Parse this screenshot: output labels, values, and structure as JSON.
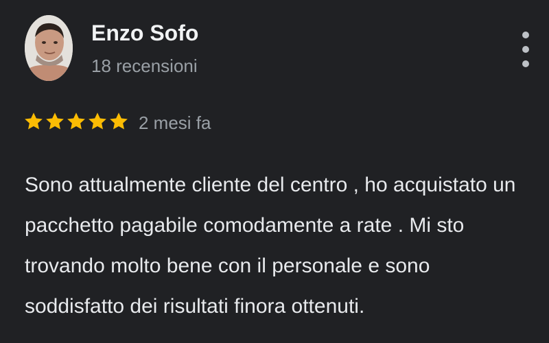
{
  "review": {
    "author": {
      "name": "Enzo Sofo",
      "reviews_count": "18 recensioni",
      "avatar_icon": "user-avatar-photo"
    },
    "rating": {
      "stars": 5,
      "max_stars": 5,
      "star_color": "#fbbc04",
      "time_ago": "2 mesi fa"
    },
    "text_lines": [
      "Sono attualmente cliente del centro , ho acquistato un",
      "pacchetto pagabile comodamente a rate . Mi sto",
      "trovando molto bene con il personale e sono",
      "soddisfatto dei risultati finora ottenuti."
    ],
    "menu_icon": "more-vert-icon"
  },
  "colors": {
    "background": "#202124",
    "primary_text": "#f1f3f4",
    "secondary_text": "#9aa0a6"
  }
}
